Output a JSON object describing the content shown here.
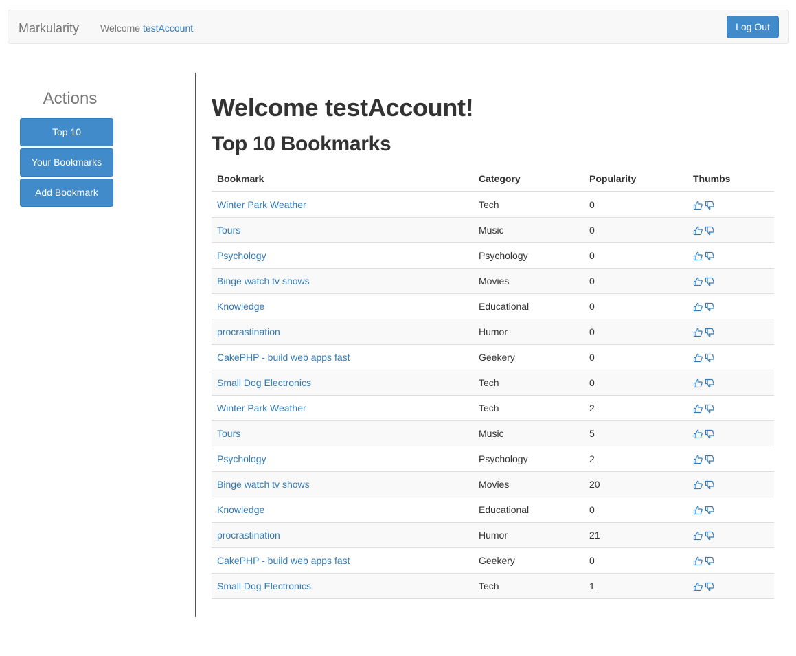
{
  "navbar": {
    "brand": "Markularity",
    "welcome_prefix": "Welcome",
    "username": "testAccount",
    "logout_label": "Log Out"
  },
  "sidebar": {
    "title": "Actions",
    "buttons": [
      "Top 10",
      "Your Bookmarks",
      "Add Bookmark"
    ]
  },
  "main": {
    "heading": "Welcome testAccount!",
    "subheading": "Top 10 Bookmarks",
    "columns": [
      "Bookmark",
      "Category",
      "Popularity",
      "Thumbs"
    ],
    "rows": [
      {
        "bookmark": "Winter Park Weather",
        "category": "Tech",
        "popularity": "0"
      },
      {
        "bookmark": "Tours",
        "category": "Music",
        "popularity": "0"
      },
      {
        "bookmark": "Psychology",
        "category": "Psychology",
        "popularity": "0"
      },
      {
        "bookmark": "Binge watch tv shows",
        "category": "Movies",
        "popularity": "0"
      },
      {
        "bookmark": "Knowledge",
        "category": "Educational",
        "popularity": "0"
      },
      {
        "bookmark": "procrastination",
        "category": "Humor",
        "popularity": "0"
      },
      {
        "bookmark": "CakePHP - build web apps fast",
        "category": "Geekery",
        "popularity": "0"
      },
      {
        "bookmark": "Small Dog Electronics",
        "category": "Tech",
        "popularity": "0"
      },
      {
        "bookmark": "Winter Park Weather",
        "category": "Tech",
        "popularity": "2"
      },
      {
        "bookmark": "Tours",
        "category": "Music",
        "popularity": "5"
      },
      {
        "bookmark": "Psychology",
        "category": "Psychology",
        "popularity": "2"
      },
      {
        "bookmark": "Binge watch tv shows",
        "category": "Movies",
        "popularity": "20"
      },
      {
        "bookmark": "Knowledge",
        "category": "Educational",
        "popularity": "0"
      },
      {
        "bookmark": "procrastination",
        "category": "Humor",
        "popularity": "21"
      },
      {
        "bookmark": "CakePHP - build web apps fast",
        "category": "Geekery",
        "popularity": "0"
      },
      {
        "bookmark": "Small Dog Electronics",
        "category": "Tech",
        "popularity": "1"
      }
    ]
  },
  "icons": {
    "thumb_up": "thumbs-up-icon",
    "thumb_down": "thumbs-down-icon"
  },
  "colors": {
    "primary": "#428bca",
    "link": "#337ab7",
    "navbar_bg": "#f8f8f8"
  }
}
